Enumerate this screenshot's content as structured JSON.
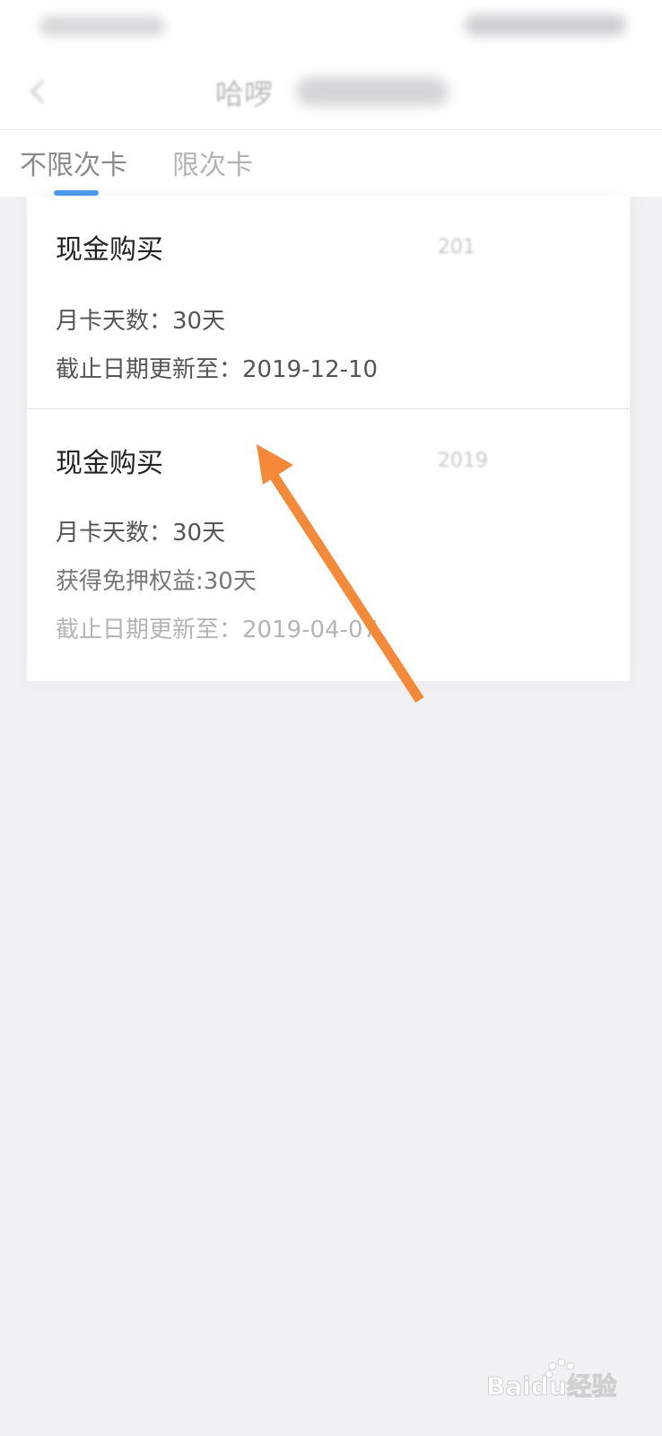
{
  "header": {
    "title_visible": "哈啰"
  },
  "tabs": [
    {
      "label": "不限次卡",
      "active": true
    },
    {
      "label": "限次卡",
      "active": false
    }
  ],
  "records": [
    {
      "title": "现金购买",
      "date_partial": "201",
      "lines": [
        "月卡天数：30天",
        "截止日期更新至：2019-12-10"
      ]
    },
    {
      "title": "现金购买",
      "date_partial": "2019",
      "lines": [
        "月卡天数：30天",
        "获得免押权益:30天",
        "截止日期更新至：2019-04-07"
      ]
    }
  ],
  "colors": {
    "accent": "#4a9cf0",
    "arrow": "#f5893a",
    "background": "#f1f1f3"
  },
  "icons": {
    "back": "arrow-left-icon",
    "annotation": "arrow-icon"
  },
  "watermark": {
    "text": "Baidu经验"
  }
}
